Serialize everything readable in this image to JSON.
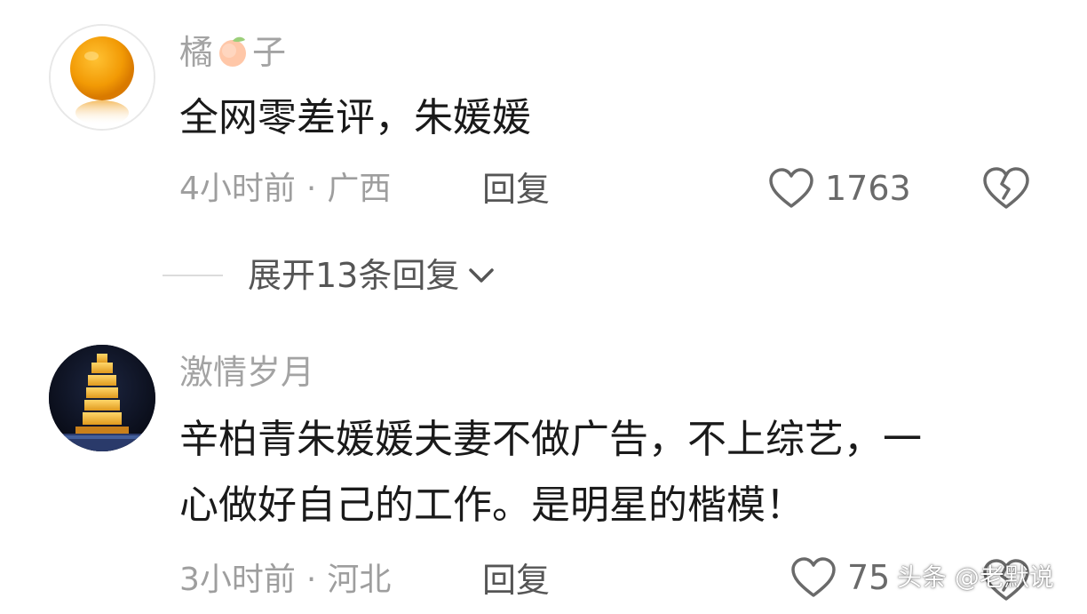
{
  "comments": [
    {
      "username_part1": "橘",
      "username_emoji": "peach-emoji",
      "username_part2": "子",
      "avatar_icon": "orange-avatar",
      "content_lines": [
        "全网零差评，朱媛媛"
      ],
      "time": "4小时前",
      "separator": "·",
      "location": "广西",
      "reply_label": "回复",
      "like_count": "1763",
      "like_icon": "heart-outline-icon",
      "dislike_icon": "broken-heart-icon"
    },
    {
      "username": "激情岁月",
      "avatar_icon": "night-pagoda-avatar",
      "content_lines": [
        "辛柏青朱媛媛夫妻不做广告，不上综艺，一",
        "心做好自己的工作。是明星的楷模！"
      ],
      "time": "3小时前",
      "separator": "·",
      "location": "河北",
      "reply_label": "回复",
      "like_count": "75",
      "like_icon": "heart-outline-icon",
      "dislike_icon": "broken-heart-icon"
    }
  ],
  "expand_replies": {
    "label": "展开13条回复",
    "icon": "chevron-down-icon"
  },
  "watermark": "头条 @老默说",
  "colors": {
    "text_primary": "#1a1a1a",
    "text_secondary": "#a3a3a3",
    "icon_gray": "#6a6a6a",
    "background": "#ffffff"
  }
}
